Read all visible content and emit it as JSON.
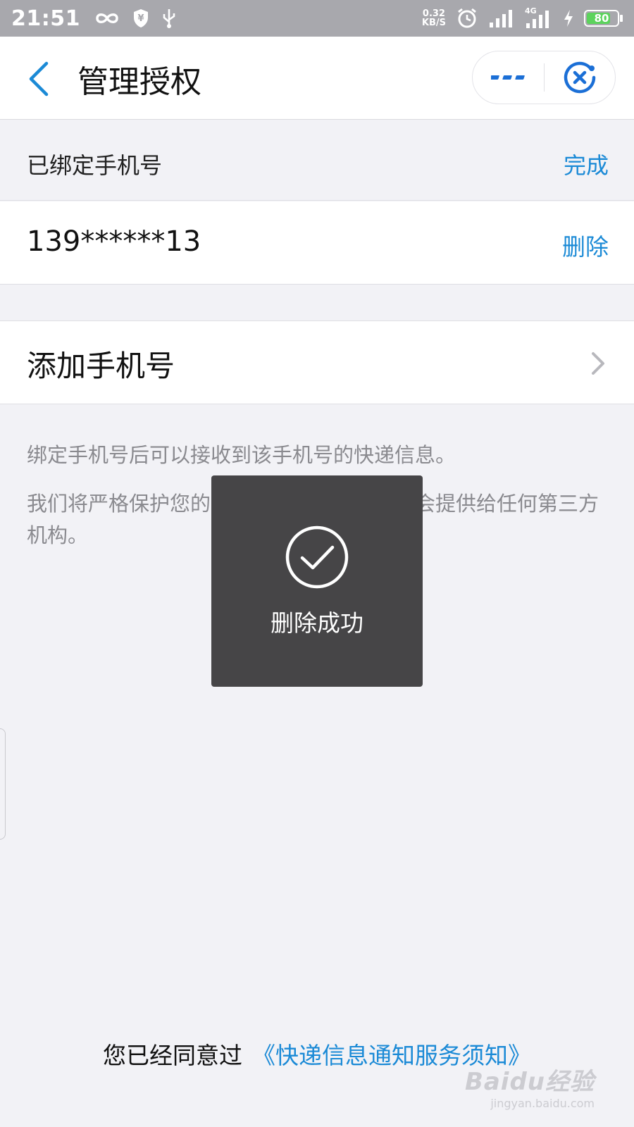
{
  "status_bar": {
    "time": "21:51",
    "net_speed_value": "0.32",
    "net_speed_unit": "KB/S",
    "network": "4G",
    "battery_level": "80",
    "battery_color": "#5cd35c"
  },
  "header": {
    "title": "管理授权"
  },
  "bound_section": {
    "title": "已绑定手机号",
    "done_label": "完成"
  },
  "phone_row": {
    "number": "139******13",
    "delete_label": "删除"
  },
  "add_row": {
    "label": "添加手机号"
  },
  "info": {
    "line1": "绑定手机号后可以接收到该手机号的快递信息。",
    "line2": "我们将严格保护您的个人信息，未经允许不会提供给任何第三方机构。"
  },
  "toast": {
    "message": "删除成功"
  },
  "footer": {
    "prefix": "您已经同意过",
    "link": "《快递信息通知服务须知》"
  },
  "watermark": {
    "main": "Baidu经验",
    "sub": "jingyan.baidu.com"
  },
  "colors": {
    "accent": "#1b8ad6",
    "status_bar": "#a8a8ad",
    "toast_bg": "#464547"
  }
}
